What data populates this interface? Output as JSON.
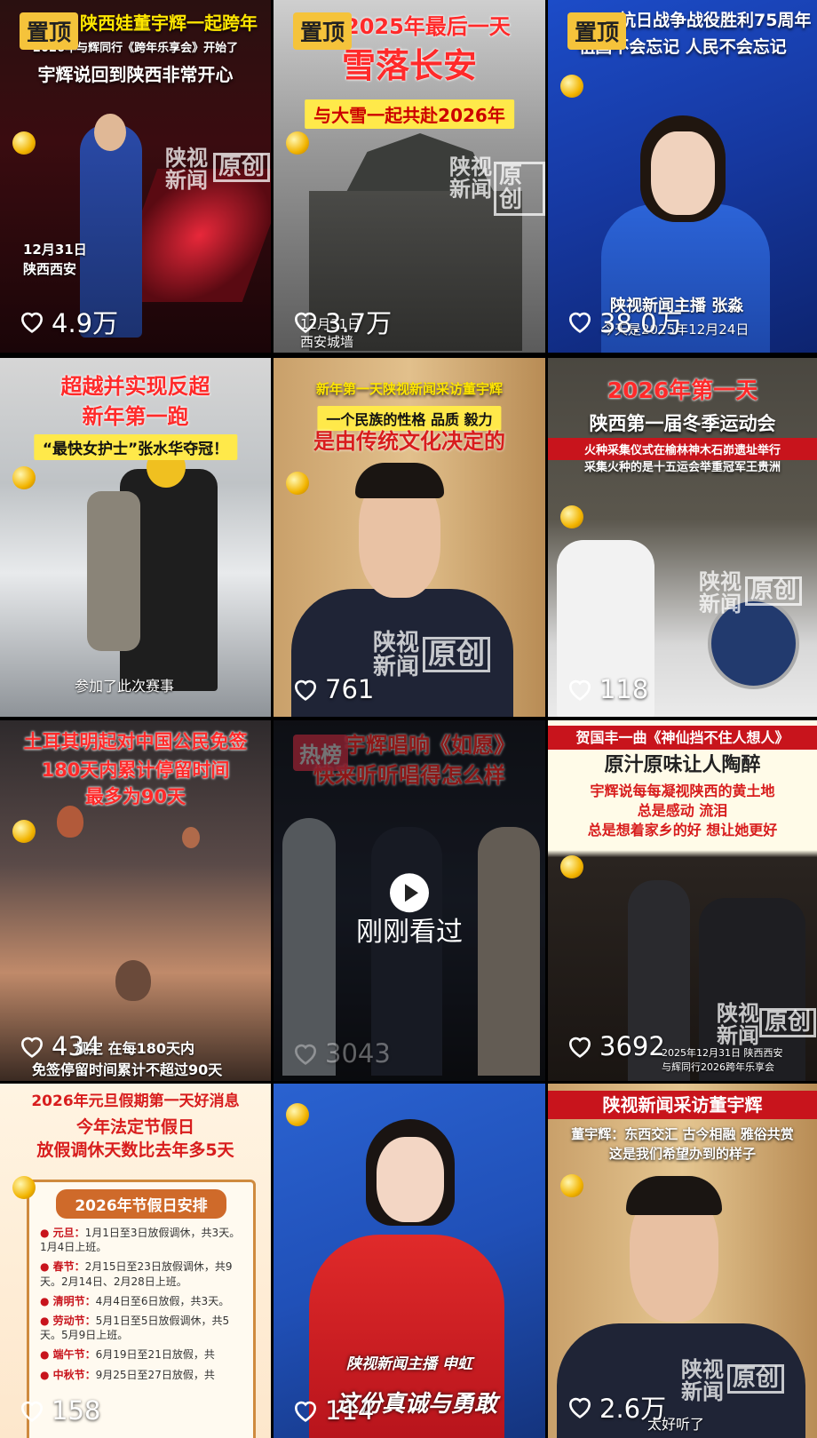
{
  "feed": {
    "pin_label": "置顶",
    "hot_label": "热榜",
    "watermark_line1": "陕视",
    "watermark_line2": "新闻",
    "watermark_box": "原创",
    "recently_watched": "刚刚看过",
    "items": [
      {
        "caption1": "陕西娃董宇辉一起跨年",
        "caption2": "2026年与辉同行《跨年乐享会》开始了",
        "caption3": "宇辉说回到陕西非常开心",
        "footer1": "12月31日",
        "footer2": "陕西西安",
        "likes": "4.9万"
      },
      {
        "caption1": "2025年最后一天",
        "caption2": "雪落长安",
        "caption3": "与大雪一起共赴2026年",
        "footer1": "12月31日",
        "footer2": "西安城墙",
        "likes": "3.7万"
      },
      {
        "caption1": "抗日战争战役胜利75周年",
        "caption2": "祖国不会忘记 人民不会忘记",
        "footer1": "陕视新闻主播 张淼",
        "footer2": "今天是2025年12月24日",
        "likes": "38.0万"
      },
      {
        "caption1": "超越并实现反超",
        "caption2": "新年第一跑",
        "caption3": "“最快女护士”张水华夺冠！",
        "footer1": "参加了此次赛事",
        "likes": ""
      },
      {
        "caption1": "新年第一天陕视新闻采访董宇辉",
        "caption2": "一个民族的性格 品质 毅力",
        "caption3": "是由传统文化决定的",
        "likes": "761"
      },
      {
        "caption1": "2026年第一天",
        "caption2": "陕西第一届冬季运动会",
        "caption3": "火种采集仪式在榆林神木石峁遗址举行",
        "caption4": "采集火种的是十五运会举重冠军王贵洲",
        "likes": "118"
      },
      {
        "caption1": "土耳其明起对中国公民免签",
        "caption2": "180天内累计停留时间",
        "caption3": "最多为90天",
        "footer1": "规定 在每180天内",
        "footer2": "免签停留时间累计不超过90天",
        "likes": "434"
      },
      {
        "caption1": "宇辉唱响《如愿》",
        "caption2": "快来听听唱得怎么样",
        "likes": "3043"
      },
      {
        "caption1": "贺国丰一曲《神仙挡不住人想人》",
        "caption2": "原汁原味让人陶醉",
        "caption3": "宇辉说每每凝视陕西的黄土地",
        "caption4": "总是感动 流泪",
        "caption5": "总是想着家乡的好 想让她更好",
        "footer1": "2025年12月31日 陕西西安",
        "footer2": "与辉同行2026跨年乐享会",
        "likes": "3692"
      },
      {
        "caption1": "2026年元旦假期第一天好消息",
        "caption2": "今年法定节假日",
        "caption3": "放假调休天数比去年多5天",
        "table_title": "2026年节假日安排",
        "rows": [
          {
            "k": "元旦：",
            "v": "1月1日至3日放假调休，共3天。1月4日上班。"
          },
          {
            "k": "春节：",
            "v": "2月15日至23日放假调休，共9天。2月14日、2月28日上班。"
          },
          {
            "k": "清明节：",
            "v": "4月4日至6日放假，共3天。"
          },
          {
            "k": "劳动节：",
            "v": "5月1日至5日放假调休，共5天。5月9日上班。"
          },
          {
            "k": "端午节：",
            "v": "6月19日至21日放假，共"
          },
          {
            "k": "中秋节：",
            "v": "9月25日至27日放假，共"
          }
        ],
        "likes": "158"
      },
      {
        "caption1": "陕视新闻主播 申虹",
        "caption2": "这份真诚与勇敢",
        "likes": "114"
      },
      {
        "caption1": "陕视新闻采访董宇辉",
        "caption2": "董宇辉：东西交汇 古今相融 雅俗共赏",
        "caption3": "这是我们希望办到的样子",
        "footer1": "太好听了",
        "likes": "2.6万"
      }
    ]
  },
  "colors": {
    "pin": "#f5c33b",
    "hot": "#ff3b58",
    "caption_red": "#ff2a2a"
  }
}
